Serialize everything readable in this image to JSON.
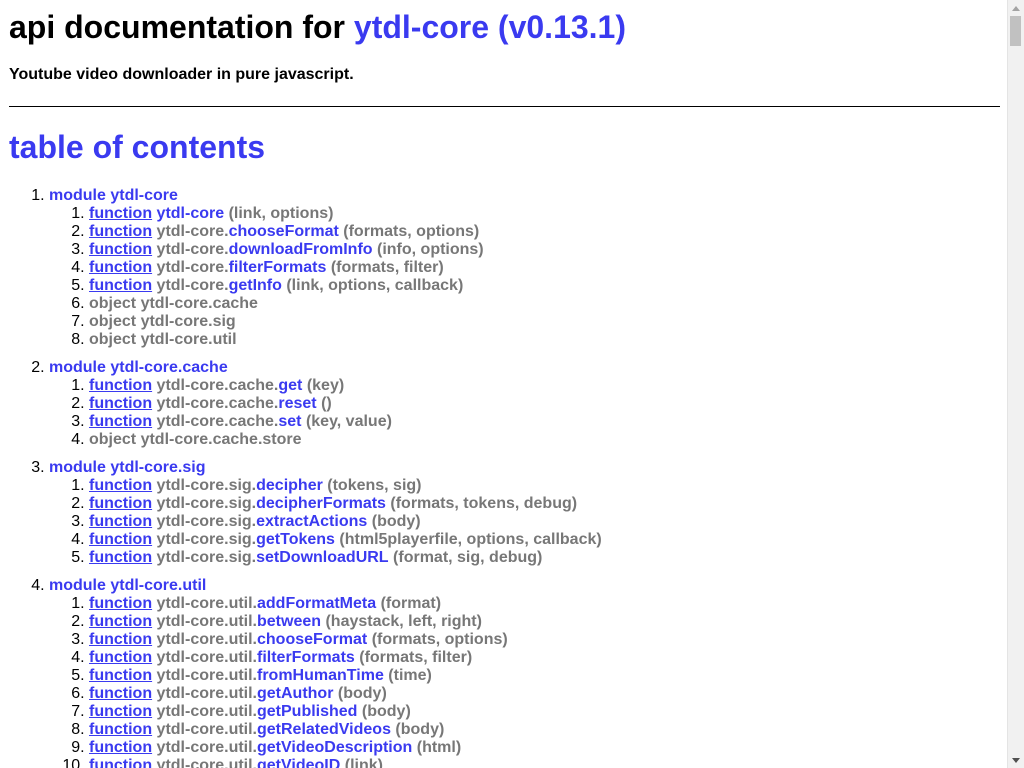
{
  "header": {
    "title_prefix": "api documentation for",
    "package_name": "ytdl-core",
    "package_version": "(v0.13.1)",
    "tagline": "Youtube video downloader in pure javascript."
  },
  "toc": {
    "heading": "table of contents",
    "modules": [
      {
        "title": "module ytdl-core",
        "items": [
          {
            "kind": "function",
            "ns": "",
            "name": "ytdl-core",
            "sig": "(link, options)"
          },
          {
            "kind": "function",
            "ns": "ytdl-core.",
            "name": "chooseFormat",
            "sig": "(formats, options)"
          },
          {
            "kind": "function",
            "ns": "ytdl-core.",
            "name": "downloadFromInfo",
            "sig": "(info, options)"
          },
          {
            "kind": "function",
            "ns": "ytdl-core.",
            "name": "filterFormats",
            "sig": "(formats, filter)"
          },
          {
            "kind": "function",
            "ns": "ytdl-core.",
            "name": "getInfo",
            "sig": "(link, options, callback)"
          },
          {
            "kind": "object",
            "text": "object ytdl-core.cache"
          },
          {
            "kind": "object",
            "text": "object ytdl-core.sig"
          },
          {
            "kind": "object",
            "text": "object ytdl-core.util"
          }
        ]
      },
      {
        "title": "module ytdl-core.cache",
        "items": [
          {
            "kind": "function",
            "ns": "ytdl-core.cache.",
            "name": "get",
            "sig": "(key)"
          },
          {
            "kind": "function",
            "ns": "ytdl-core.cache.",
            "name": "reset",
            "sig": "()"
          },
          {
            "kind": "function",
            "ns": "ytdl-core.cache.",
            "name": "set",
            "sig": "(key, value)"
          },
          {
            "kind": "object",
            "text": "object ytdl-core.cache.store"
          }
        ]
      },
      {
        "title": "module ytdl-core.sig",
        "items": [
          {
            "kind": "function",
            "ns": "ytdl-core.sig.",
            "name": "decipher",
            "sig": "(tokens, sig)"
          },
          {
            "kind": "function",
            "ns": "ytdl-core.sig.",
            "name": "decipherFormats",
            "sig": "(formats, tokens, debug)"
          },
          {
            "kind": "function",
            "ns": "ytdl-core.sig.",
            "name": "extractActions",
            "sig": "(body)"
          },
          {
            "kind": "function",
            "ns": "ytdl-core.sig.",
            "name": "getTokens",
            "sig": "(html5playerfile, options, callback)"
          },
          {
            "kind": "function",
            "ns": "ytdl-core.sig.",
            "name": "setDownloadURL",
            "sig": "(format, sig, debug)"
          }
        ]
      },
      {
        "title": "module ytdl-core.util",
        "items": [
          {
            "kind": "function",
            "ns": "ytdl-core.util.",
            "name": "addFormatMeta",
            "sig": "(format)"
          },
          {
            "kind": "function",
            "ns": "ytdl-core.util.",
            "name": "between",
            "sig": "(haystack, left, right)"
          },
          {
            "kind": "function",
            "ns": "ytdl-core.util.",
            "name": "chooseFormat",
            "sig": "(formats, options)"
          },
          {
            "kind": "function",
            "ns": "ytdl-core.util.",
            "name": "filterFormats",
            "sig": "(formats, filter)"
          },
          {
            "kind": "function",
            "ns": "ytdl-core.util.",
            "name": "fromHumanTime",
            "sig": "(time)"
          },
          {
            "kind": "function",
            "ns": "ytdl-core.util.",
            "name": "getAuthor",
            "sig": "(body)"
          },
          {
            "kind": "function",
            "ns": "ytdl-core.util.",
            "name": "getPublished",
            "sig": "(body)"
          },
          {
            "kind": "function",
            "ns": "ytdl-core.util.",
            "name": "getRelatedVideos",
            "sig": "(body)"
          },
          {
            "kind": "function",
            "ns": "ytdl-core.util.",
            "name": "getVideoDescription",
            "sig": "(html)"
          },
          {
            "kind": "function",
            "ns": "ytdl-core.util.",
            "name": "getVideoID",
            "sig": "(link)"
          }
        ]
      }
    ]
  },
  "colors": {
    "link": "#3a3af0",
    "muted": "#777777",
    "text": "#000000"
  }
}
